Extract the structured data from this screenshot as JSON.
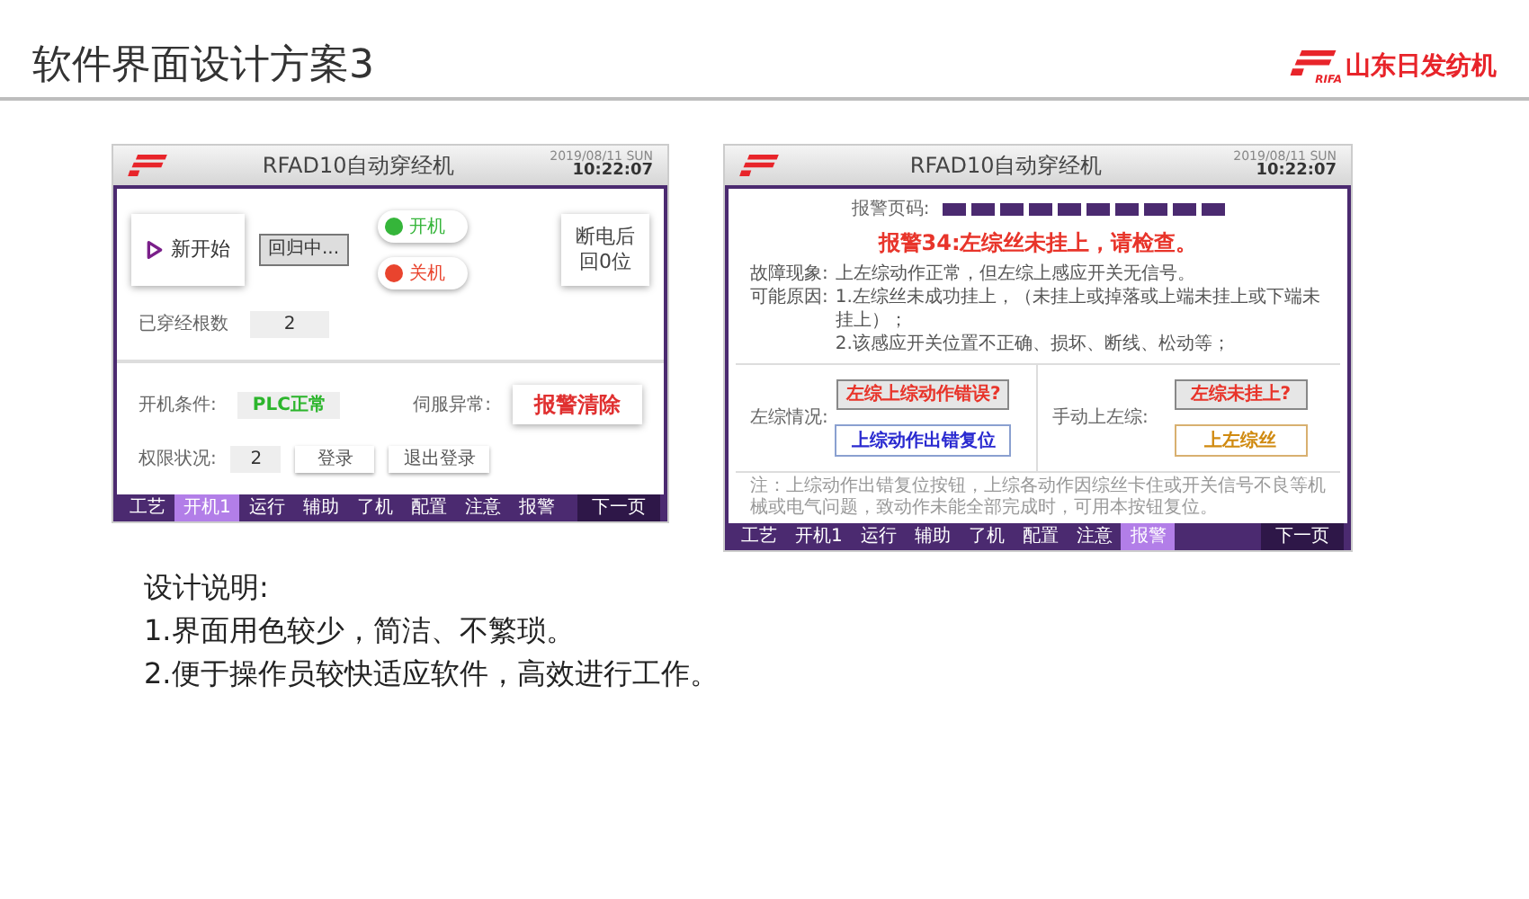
{
  "slide": {
    "title": "软件界面设计方案3",
    "brand": {
      "mark": "RIFA",
      "name": "山东日发纺机"
    }
  },
  "screen_start": {
    "title": "RFAD10自动穿经机",
    "date": "2019/08/11 SUN",
    "time": "10:22:07",
    "new_start": "新开始",
    "homing": "回归中...",
    "switches": [
      {
        "label": "开机",
        "color": "#35b53a"
      },
      {
        "label": "关机",
        "color": "#e9442e"
      }
    ],
    "power_reset": [
      "断电后",
      "回0位"
    ],
    "count_label": "已穿经根数",
    "count_value": "2",
    "condition_label": "开机条件:",
    "condition_value": "PLC正常",
    "servo_label": "伺服异常:",
    "alarm_clear": "报警清除",
    "permission_label": "权限状况:",
    "permission_value": "2",
    "login": "登录",
    "logout": "退出登录",
    "tabs": [
      {
        "label": "工艺",
        "selected": false
      },
      {
        "label": "开机1",
        "selected": true
      },
      {
        "label": "运行",
        "selected": false
      },
      {
        "label": "辅助",
        "selected": false
      },
      {
        "label": "了机",
        "selected": false
      },
      {
        "label": "配置",
        "selected": false
      },
      {
        "label": "注意",
        "selected": false
      },
      {
        "label": "报警",
        "selected": false
      }
    ],
    "next_page": "下一页"
  },
  "screen_alarm": {
    "title": "RFAD10自动穿经机",
    "date": "2019/08/11 SUN",
    "time": "10:22:07",
    "page_label": "报警页码:",
    "alarm_title": "报警34:左综丝未挂上，请检查。",
    "symptom_label": "故障现象:",
    "symptom": "上左综动作正常，但左综上感应开关无信号。",
    "cause_label": "可能原因:",
    "causes": [
      "1.左综丝未成功挂上，（未挂上或掉落或上端未挂上或下端未挂上）；",
      "2.该感应开关位置不正确、损坏、断线、松动等；"
    ],
    "left_label": "左综情况:",
    "left_status": "左综上综动作错误?",
    "left_button": "上综动作出错复位",
    "right_label": "手动上左综:",
    "right_status": "左综未挂上?",
    "right_button": "上左综丝",
    "note": "注：上综动作出错复位按钮，上综各动作因综丝卡住或开关信号不良等机械或电气问题，致动作未能全部完成时，可用本按钮复位。",
    "tabs": [
      {
        "label": "工艺",
        "selected": false
      },
      {
        "label": "开机1",
        "selected": false
      },
      {
        "label": "运行",
        "selected": false
      },
      {
        "label": "辅助",
        "selected": false
      },
      {
        "label": "了机",
        "selected": false
      },
      {
        "label": "配置",
        "selected": false
      },
      {
        "label": "注意",
        "selected": false
      },
      {
        "label": "报警",
        "selected": true
      }
    ],
    "next_page": "下一页"
  },
  "notes": {
    "heading": "设计说明:",
    "items": [
      "1.界面用色较少，简洁、不繁琐。",
      "2.便于操作员较快适应软件，高效进行工作。"
    ]
  }
}
